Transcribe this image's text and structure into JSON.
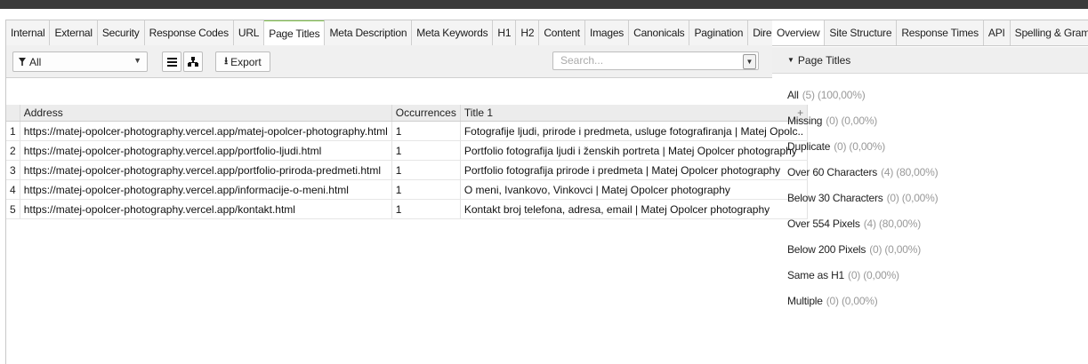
{
  "left_tabs": [
    "Internal",
    "External",
    "Security",
    "Response Codes",
    "URL",
    "Page Titles",
    "Meta Description",
    "Meta Keywords",
    "H1",
    "H2",
    "Content",
    "Images",
    "Canonicals",
    "Pagination",
    "Directiv"
  ],
  "active_tab": "Page Titles",
  "toolbar": {
    "filter_value": "All",
    "export_label": "Export",
    "search_placeholder": "Search..."
  },
  "table": {
    "columns": [
      "Address",
      "Occurrences",
      "Title 1"
    ],
    "rows": [
      {
        "n": "1",
        "address": "https://matej-opolcer-photography.vercel.app/matej-opolcer-photography.html",
        "occ": "1",
        "title": "Fotografije ljudi, prirode i predmeta, usluge fotografiranja | Matej Opolc.."
      },
      {
        "n": "2",
        "address": "https://matej-opolcer-photography.vercel.app/portfolio-ljudi.html",
        "occ": "1",
        "title": "Portfolio fotografija ljudi i ženskih portreta | Matej Opolcer photography"
      },
      {
        "n": "3",
        "address": "https://matej-opolcer-photography.vercel.app/portfolio-priroda-predmeti.html",
        "occ": "1",
        "title": "Portfolio fotografija prirode i predmeta | Matej Opolcer photography"
      },
      {
        "n": "4",
        "address": "https://matej-opolcer-photography.vercel.app/informacije-o-meni.html",
        "occ": "1",
        "title": "O meni, Ivankovo, Vinkovci | Matej Opolcer photography"
      },
      {
        "n": "5",
        "address": "https://matej-opolcer-photography.vercel.app/kontakt.html",
        "occ": "1",
        "title": "Kontakt broj telefona, adresa, email | Matej Opolcer photography"
      }
    ]
  },
  "right_tabs": [
    "Overview",
    "Site Structure",
    "Response Times",
    "API",
    "Spelling & Gramma"
  ],
  "right_panel": {
    "heading": "Page Titles",
    "items": [
      {
        "label": "All",
        "count": "(5) (100,00%)"
      },
      {
        "label": "Missing",
        "count": "(0) (0,00%)"
      },
      {
        "label": "Duplicate",
        "count": "(0) (0,00%)"
      },
      {
        "label": "Over 60 Characters",
        "count": "(4) (80,00%)"
      },
      {
        "label": "Below 30 Characters",
        "count": "(0) (0,00%)"
      },
      {
        "label": "Over 554 Pixels",
        "count": "(4) (80,00%)"
      },
      {
        "label": "Below 200 Pixels",
        "count": "(0) (0,00%)"
      },
      {
        "label": "Same as H1",
        "count": "(0) (0,00%)"
      },
      {
        "label": "Multiple",
        "count": "(0) (0,00%)"
      }
    ]
  },
  "colors": {
    "active_tab_accent": "#7fbf4a",
    "top_bar": "#3a3a3a"
  }
}
